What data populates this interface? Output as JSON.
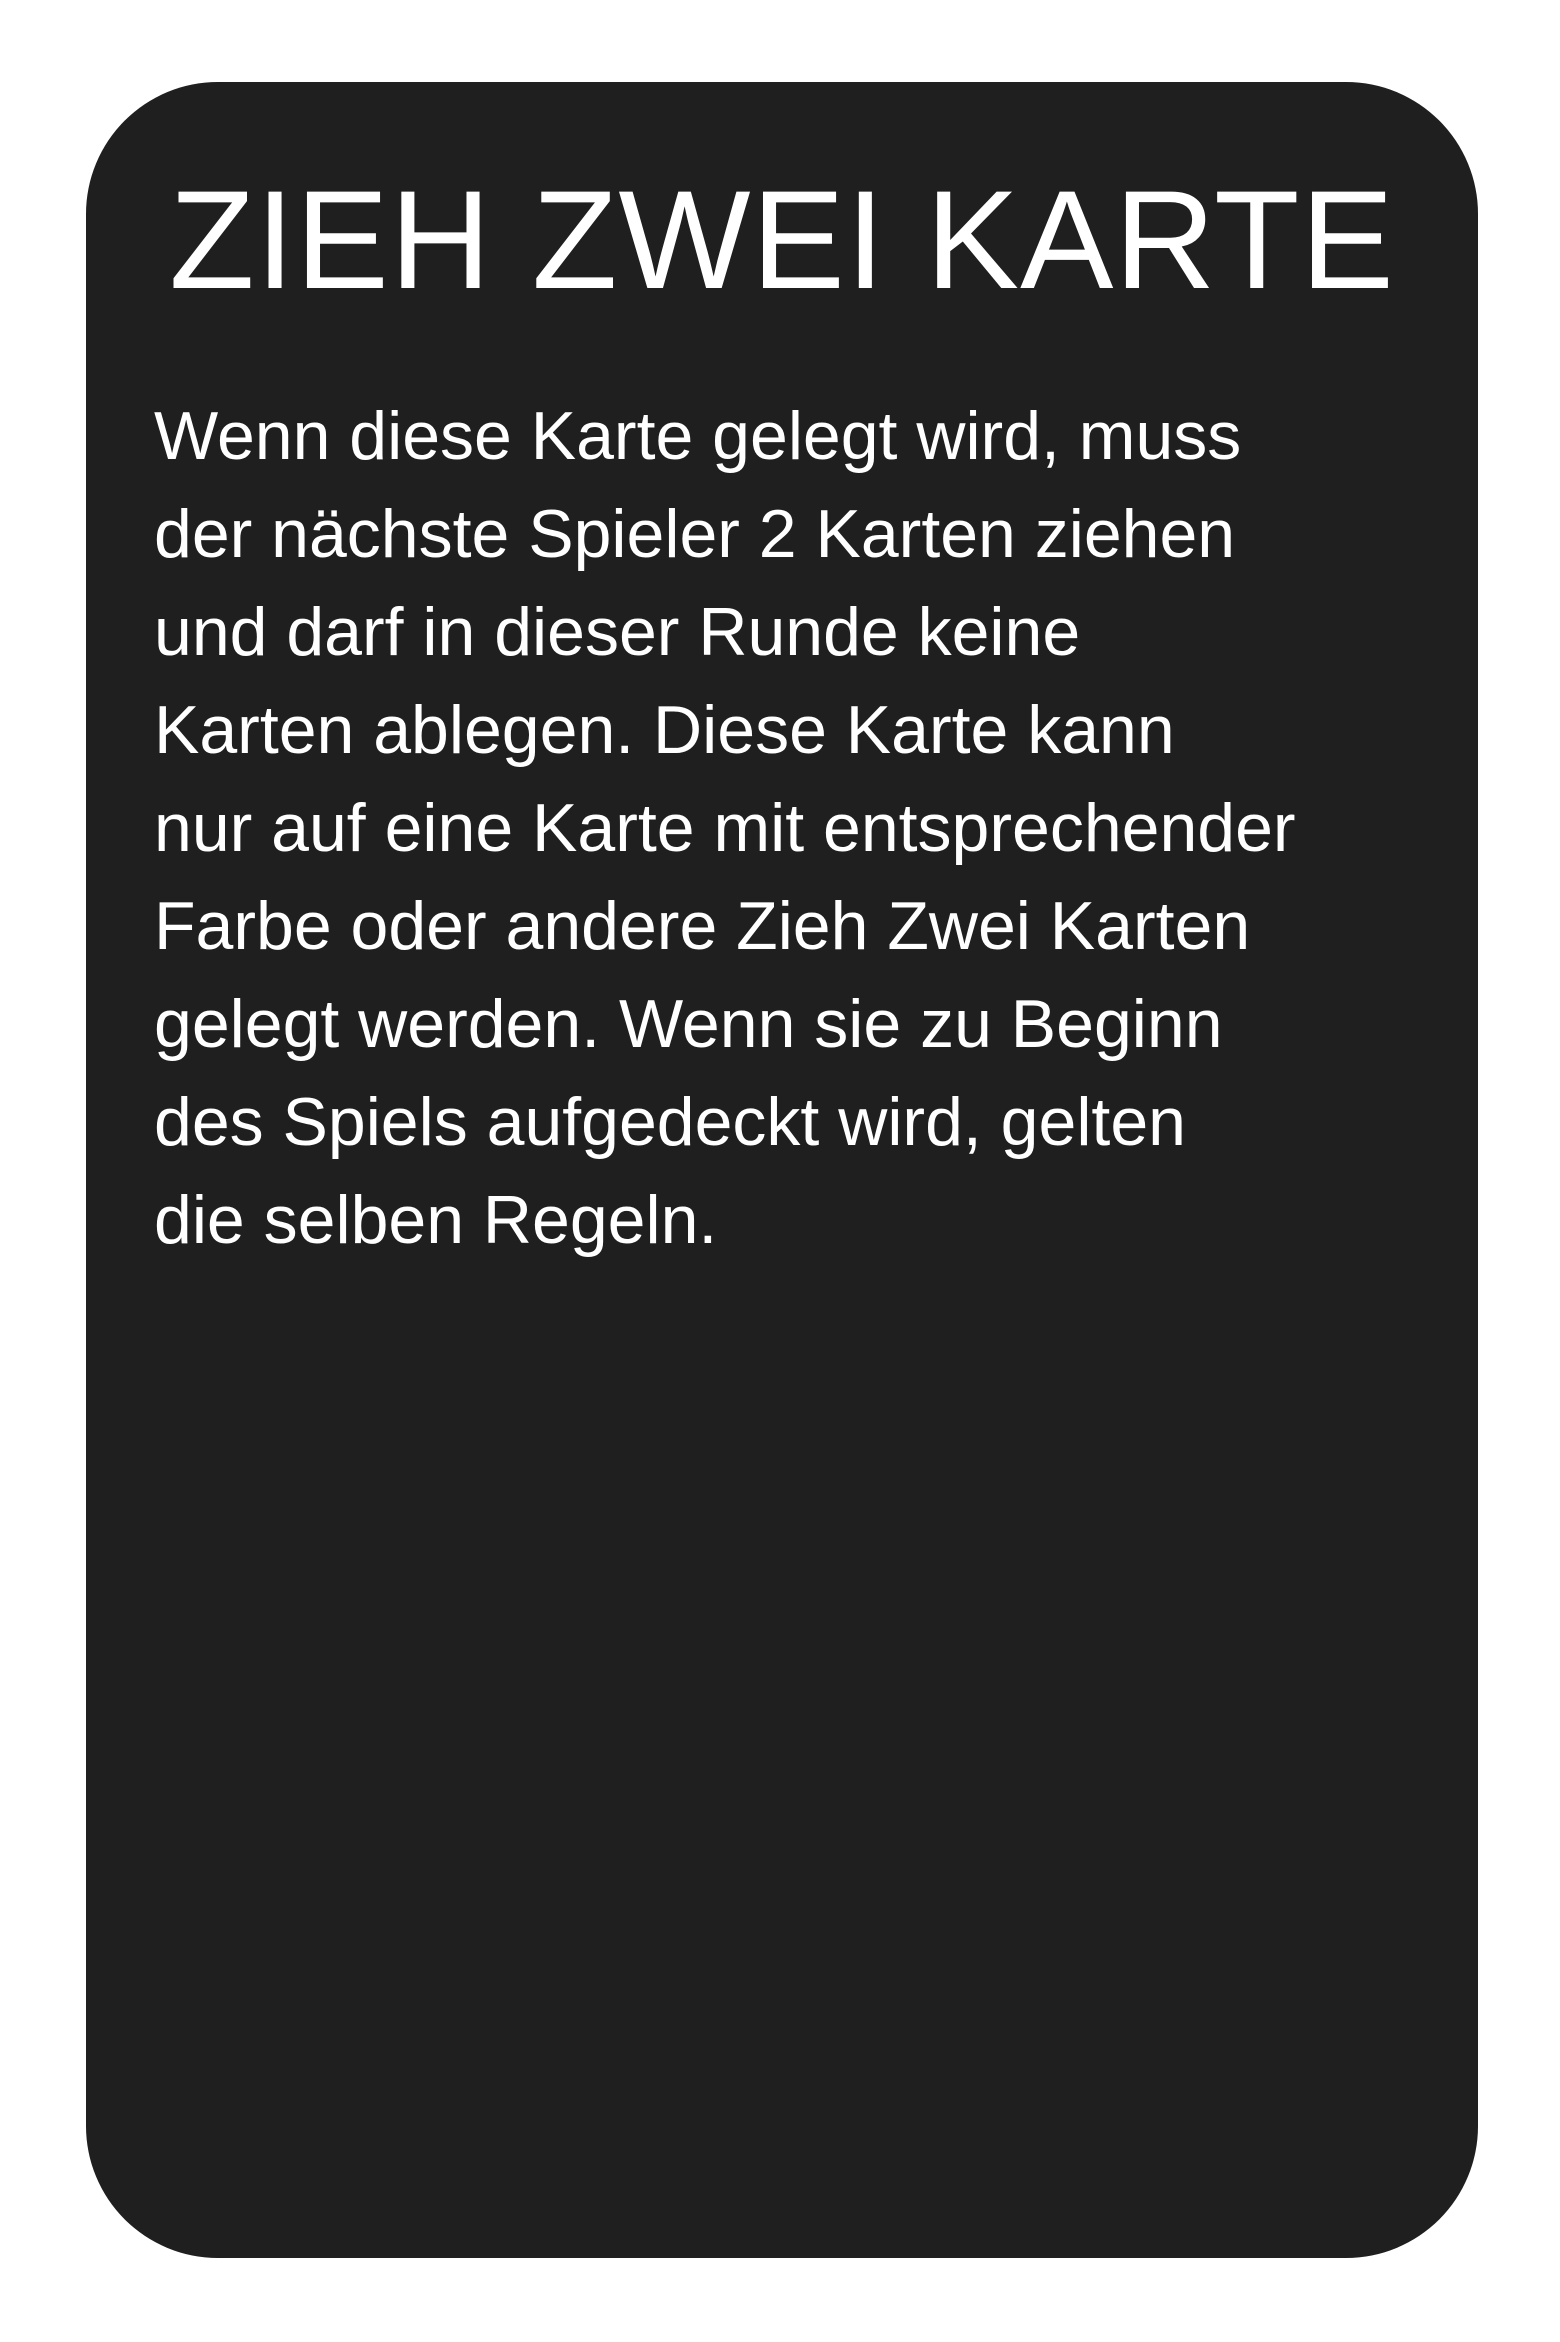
{
  "card": {
    "background_color": "#1f1f1f",
    "text_color": "#ffffff",
    "title": "ZIEH ZWEI KARTE",
    "description_lines": [
      "Wenn diese Karte gelegt wird, muss",
      "der nächste Spieler 2 Karten ziehen",
      "und darf in dieser Runde keine",
      "Karten ablegen. Diese Karte kann",
      "nur auf eine Karte mit entsprechender",
      "Farbe oder andere Zieh Zwei Karten",
      "gelegt werden. Wenn sie zu Beginn",
      "des Spiels aufgedeckt wird, gelten",
      "die selben Regeln."
    ]
  }
}
